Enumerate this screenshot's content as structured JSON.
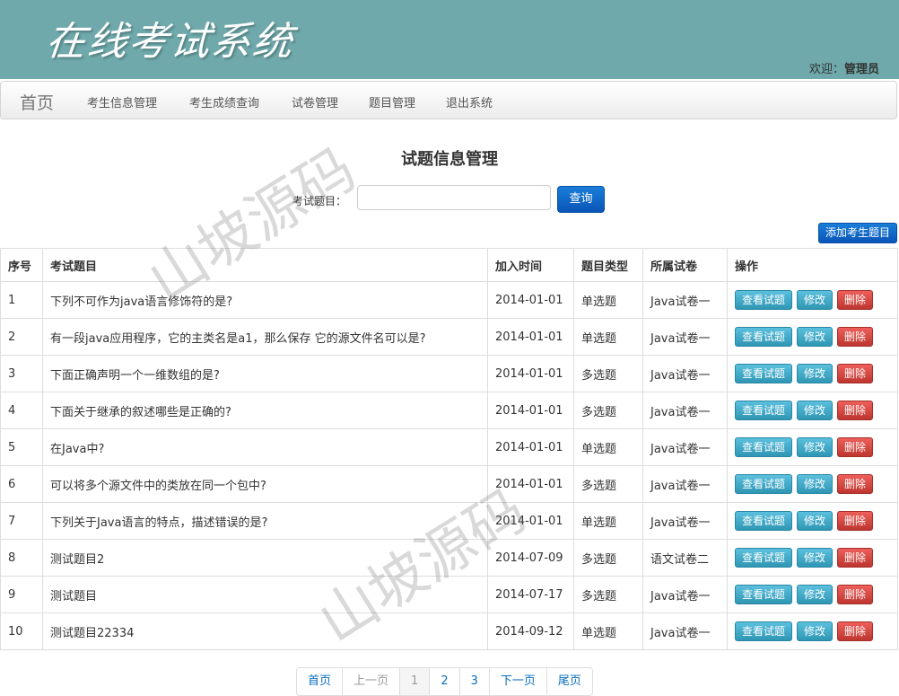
{
  "header": {
    "brand": "在线考试系统",
    "welcome_label": "欢迎：",
    "user_name": "管理员"
  },
  "nav": {
    "home": "首页",
    "items": [
      "考生信息管理",
      "考生成绩查询",
      "试卷管理",
      "题目管理",
      "退出系统"
    ]
  },
  "page": {
    "title": "试题信息管理",
    "search_label": "考试题目：",
    "search_value": "",
    "search_button": "查询",
    "add_button": "添加考生题目"
  },
  "table": {
    "headers": [
      "序号",
      "考试题目",
      "加入时间",
      "题目类型",
      "所属试卷",
      "操作"
    ],
    "actions": {
      "view": "查看试题",
      "edit": "修改",
      "delete": "删除"
    },
    "rows": [
      {
        "no": "1",
        "title": "下列不可作为java语言修饰符的是?",
        "date": "2014-01-01",
        "type": "单选题",
        "paper": "Java试卷一"
      },
      {
        "no": "2",
        "title": "有一段java应用程序，它的主类名是a1，那么保存 它的源文件名可以是?",
        "date": "2014-01-01",
        "type": "单选题",
        "paper": "Java试卷一"
      },
      {
        "no": "3",
        "title": "下面正确声明一个一维数组的是?",
        "date": "2014-01-01",
        "type": "多选题",
        "paper": "Java试卷一"
      },
      {
        "no": "4",
        "title": "下面关于继承的叙述哪些是正确的?",
        "date": "2014-01-01",
        "type": "多选题",
        "paper": "Java试卷一"
      },
      {
        "no": "5",
        "title": "在Java中?",
        "date": "2014-01-01",
        "type": "单选题",
        "paper": "Java试卷一"
      },
      {
        "no": "6",
        "title": "可以将多个源文件中的类放在同一个包中?",
        "date": "2014-01-01",
        "type": "多选题",
        "paper": "Java试卷一"
      },
      {
        "no": "7",
        "title": "下列关于Java语言的特点，描述错误的是?",
        "date": "2014-01-01",
        "type": "单选题",
        "paper": "Java试卷一"
      },
      {
        "no": "8",
        "title": "测试题目2",
        "date": "2014-07-09",
        "type": "多选题",
        "paper": "语文试卷二"
      },
      {
        "no": "9",
        "title": "测试题目",
        "date": "2014-07-17",
        "type": "多选题",
        "paper": "Java试卷一"
      },
      {
        "no": "10",
        "title": "测试题目22334",
        "date": "2014-09-12",
        "type": "单选题",
        "paper": "Java试卷一"
      }
    ]
  },
  "pager": {
    "first": "首页",
    "prev": "上一页",
    "pages": [
      "1",
      "2",
      "3"
    ],
    "current_page": "1",
    "next": "下一页",
    "last": "尾页"
  },
  "watermark": "山坡源码"
}
